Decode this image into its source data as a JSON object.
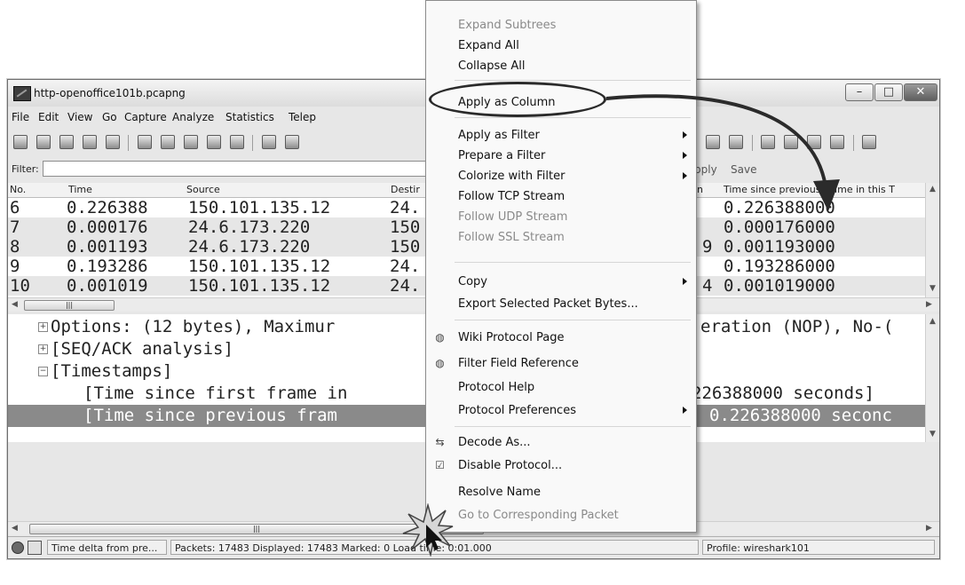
{
  "window": {
    "title": "http-openoffice101b.pcapng",
    "min_icon": "minimize-icon",
    "max_icon": "maximize-icon",
    "close_icon": "close-icon"
  },
  "menubar": [
    "File",
    "Edit",
    "View",
    "Go",
    "Capture",
    "Analyze",
    "Statistics",
    "Telep"
  ],
  "filter": {
    "label": "Filter:",
    "value": "",
    "apply_label": "pply",
    "save_label": "Save"
  },
  "packet_list": {
    "columns": [
      "No.",
      "Time",
      "Source",
      "Destir",
      "n",
      "Time since previous frame in this T"
    ],
    "rows": [
      {
        "no": "6",
        "time": "0.226388",
        "source": "150.101.135.12",
        "dest": "24.",
        "extra": "",
        "delta": "0.226388000"
      },
      {
        "no": "7",
        "time": "0.000176",
        "source": "24.6.173.220",
        "dest": "150",
        "extra": "",
        "delta": "0.000176000"
      },
      {
        "no": "8",
        "time": "0.001193",
        "source": "24.6.173.220",
        "dest": "150",
        "extra": "9",
        "delta": "0.001193000"
      },
      {
        "no": "9",
        "time": "0.193286",
        "source": "150.101.135.12",
        "dest": "24.",
        "extra": "",
        "delta": "0.193286000"
      },
      {
        "no": "10",
        "time": "0.001019",
        "source": "150.101.135.12",
        "dest": "24.",
        "extra": "4",
        "delta": "0.001019000"
      }
    ]
  },
  "details": [
    {
      "expander": "+",
      "left": "Options: (12 bytes), Maximur",
      "right": "eration (NOP), No-("
    },
    {
      "expander": "+",
      "left": "[SEQ/ACK analysis]",
      "right": ""
    },
    {
      "expander": "−",
      "left": "[Timestamps]",
      "right": ""
    },
    {
      "expander": "",
      "left": "[Time since first frame in",
      "right": "226388000 seconds]"
    },
    {
      "expander": "",
      "left": "[Time since previous fram",
      "right": "0.226388000 seconc"
    }
  ],
  "statusbar": {
    "field_hint": "Time delta from pre...",
    "packets": "Packets: 17483 Displayed: 17483 Marked: 0 Load time: 0:01.000",
    "profile": "Profile: wireshark101"
  },
  "context_menu": {
    "items": [
      {
        "label": "Expand Subtrees",
        "disabled": true
      },
      {
        "label": "Expand All"
      },
      {
        "label": "Collapse All"
      },
      {
        "sep": true
      },
      {
        "label": "Apply as Column",
        "highlighted": true
      },
      {
        "sep": true
      },
      {
        "label": "Apply as Filter",
        "submenu": true
      },
      {
        "label": "Prepare a Filter",
        "submenu": true
      },
      {
        "label": "Colorize with Filter",
        "submenu": true
      },
      {
        "label": "Follow TCP Stream"
      },
      {
        "label": "Follow UDP Stream",
        "disabled": true
      },
      {
        "label": "Follow SSL Stream",
        "disabled": true
      },
      {
        "sep": true
      },
      {
        "label": "Copy",
        "submenu": true
      },
      {
        "label": "Export Selected Packet Bytes..."
      },
      {
        "sep": true
      },
      {
        "label": "Wiki Protocol Page",
        "icon": "globe-icon"
      },
      {
        "label": "Filter Field Reference",
        "icon": "globe-icon"
      },
      {
        "label": "Protocol Help"
      },
      {
        "label": "Protocol Preferences",
        "submenu": true
      },
      {
        "sep": true
      },
      {
        "label": "Decode As...",
        "icon": "decode-icon"
      },
      {
        "label": "Disable Protocol...",
        "icon": "checkbox-icon"
      },
      {
        "label": "Resolve Name"
      },
      {
        "label": "Go to Corresponding Packet",
        "disabled": true
      }
    ]
  },
  "annotation": {
    "callout_color": "#2b2b2b"
  }
}
